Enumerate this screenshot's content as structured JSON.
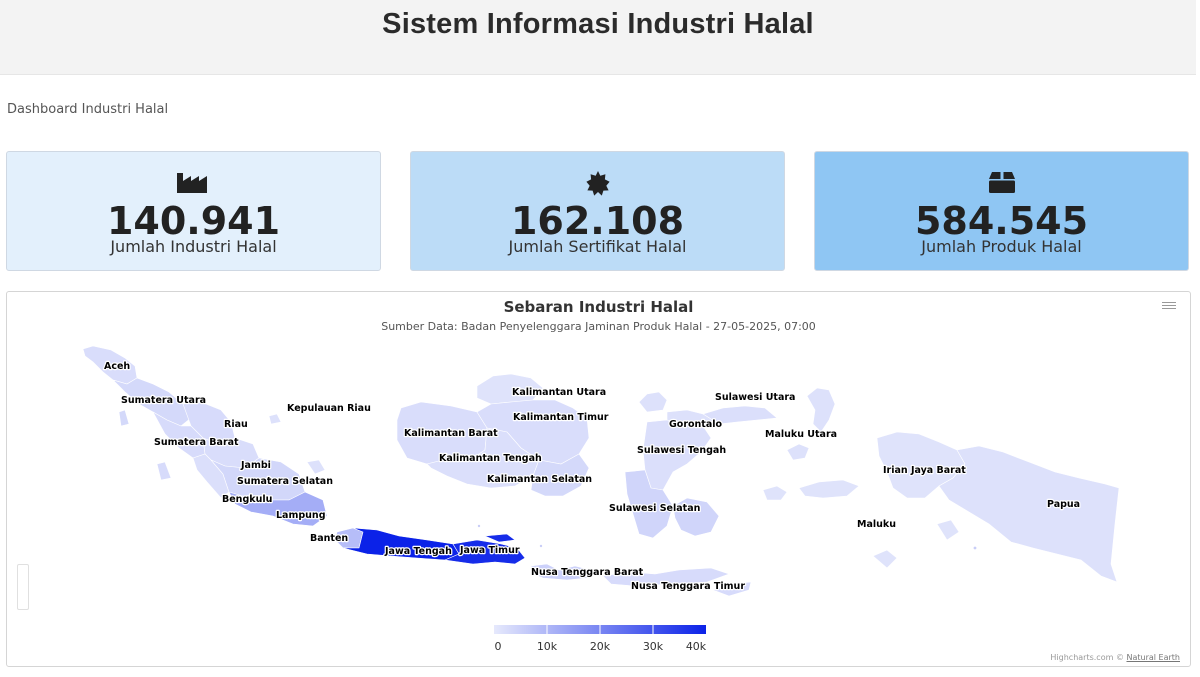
{
  "header": {
    "title": "Sistem Informasi Industri Halal"
  },
  "breadcrumb": "Dashboard Industri Halal",
  "cards": [
    {
      "icon": "factory-icon",
      "value": "140.941",
      "label": "Jumlah Industri Halal"
    },
    {
      "icon": "certificate-icon",
      "value": "162.108",
      "label": "Jumlah Sertifikat Halal"
    },
    {
      "icon": "box-icon",
      "value": "584.545",
      "label": "Jumlah Produk Halal"
    }
  ],
  "colors": {
    "card1": "#e3f0fc",
    "card2": "#bcdcf7",
    "card3": "#8fc6f3",
    "scale_min": "#e6e9fc",
    "scale_max": "#0b22e8"
  },
  "map": {
    "title": "Sebaran Industri Halal",
    "subtitle": "Sumber Data: Badan Penyelenggara Jaminan Produk Halal - 27-05-2025, 07:00",
    "legend_ticks": [
      "0",
      "10k",
      "20k",
      "30k",
      "40k"
    ],
    "credits": {
      "brand": "Highcharts.com",
      "sep": "©",
      "source": "Natural Earth"
    },
    "provinces": [
      {
        "name": "Aceh",
        "level": 0.06
      },
      {
        "name": "Sumatera Utara",
        "level": 0.08
      },
      {
        "name": "Riau",
        "level": 0.07
      },
      {
        "name": "Kepulauan Riau",
        "level": 0.04
      },
      {
        "name": "Sumatera Barat",
        "level": 0.07
      },
      {
        "name": "Jambi",
        "level": 0.06
      },
      {
        "name": "Sumatera Selatan",
        "level": 0.09
      },
      {
        "name": "Bengkulu",
        "level": 0.05
      },
      {
        "name": "Lampung",
        "level": 0.3
      },
      {
        "name": "Banten",
        "level": 0.22
      },
      {
        "name": "Jawa Tengah",
        "level": 1.0
      },
      {
        "name": "Jawa Timur",
        "level": 0.95
      },
      {
        "name": "Kalimantan Utara",
        "level": 0.03
      },
      {
        "name": "Kalimantan Timur",
        "level": 0.06
      },
      {
        "name": "Kalimantan Barat",
        "level": 0.06
      },
      {
        "name": "Kalimantan Tengah",
        "level": 0.05
      },
      {
        "name": "Kalimantan Selatan",
        "level": 0.08
      },
      {
        "name": "Sulawesi Utara",
        "level": 0.05
      },
      {
        "name": "Gorontalo",
        "level": 0.04
      },
      {
        "name": "Sulawesi Tengah",
        "level": 0.05
      },
      {
        "name": "Sulawesi Selatan",
        "level": 0.1
      },
      {
        "name": "Maluku Utara",
        "level": 0.04
      },
      {
        "name": "Irian Jaya Barat",
        "level": 0.03
      },
      {
        "name": "Papua",
        "level": 0.04
      },
      {
        "name": "Maluku",
        "level": 0.03
      },
      {
        "name": "Nusa Tenggara Barat",
        "level": 0.12
      },
      {
        "name": "Nusa Tenggara Timur",
        "level": 0.07
      }
    ]
  }
}
